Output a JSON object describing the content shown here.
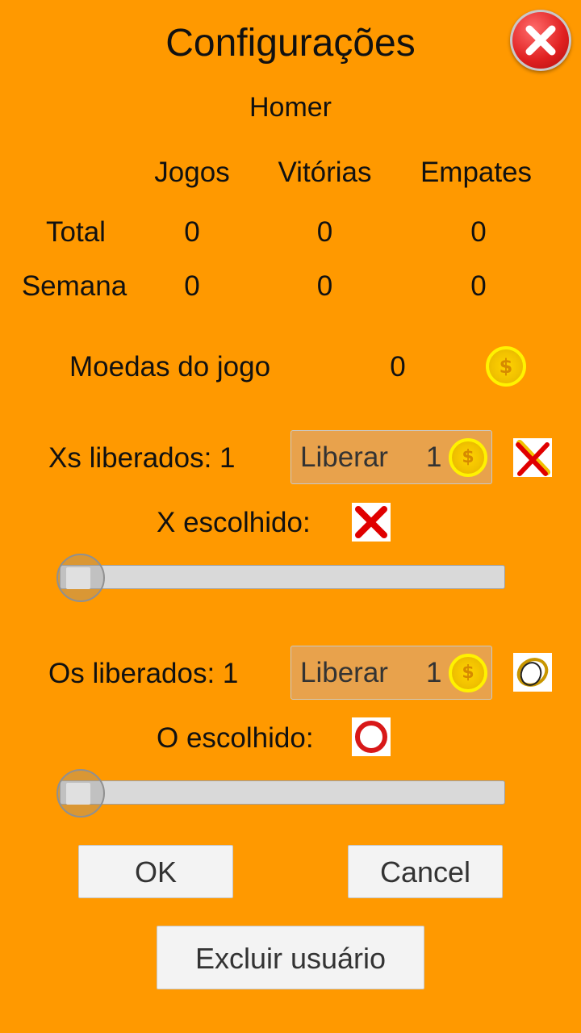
{
  "header": {
    "title": "Configurações"
  },
  "user": {
    "name": "Homer"
  },
  "stats": {
    "columns": [
      "Jogos",
      "Vitórias",
      "Empates"
    ],
    "rows": [
      {
        "label": "Total",
        "values": [
          "0",
          "0",
          "0"
        ]
      },
      {
        "label": "Semana",
        "values": [
          "0",
          "0",
          "0"
        ]
      }
    ]
  },
  "coins": {
    "label": "Moedas do jogo",
    "value": "0",
    "coin_symbol": "$"
  },
  "x_section": {
    "unlocked_label": "Xs liberados: 1",
    "unlock_button_label": "Liberar",
    "unlock_cost": "1",
    "chosen_label": "X escolhido:",
    "slider_value": 0
  },
  "o_section": {
    "unlocked_label": "Os liberados: 1",
    "unlock_button_label": "Liberar",
    "unlock_cost": "1",
    "chosen_label": "O escolhido:",
    "slider_value": 0
  },
  "buttons": {
    "ok": "OK",
    "cancel": "Cancel",
    "delete_user": "Excluir usuário"
  },
  "icons": {
    "close": "close-icon",
    "coin": "coin-icon",
    "x_next_preview": "x-piece-icon",
    "x_chosen": "x-piece-icon",
    "o_next_preview": "o-piece-icon",
    "o_chosen": "o-piece-icon"
  },
  "colors": {
    "background": "#FF9900",
    "close_button": "#E02020",
    "coin": "#F2C200",
    "x_piece": "#E00000",
    "o_piece": "#D81818"
  }
}
